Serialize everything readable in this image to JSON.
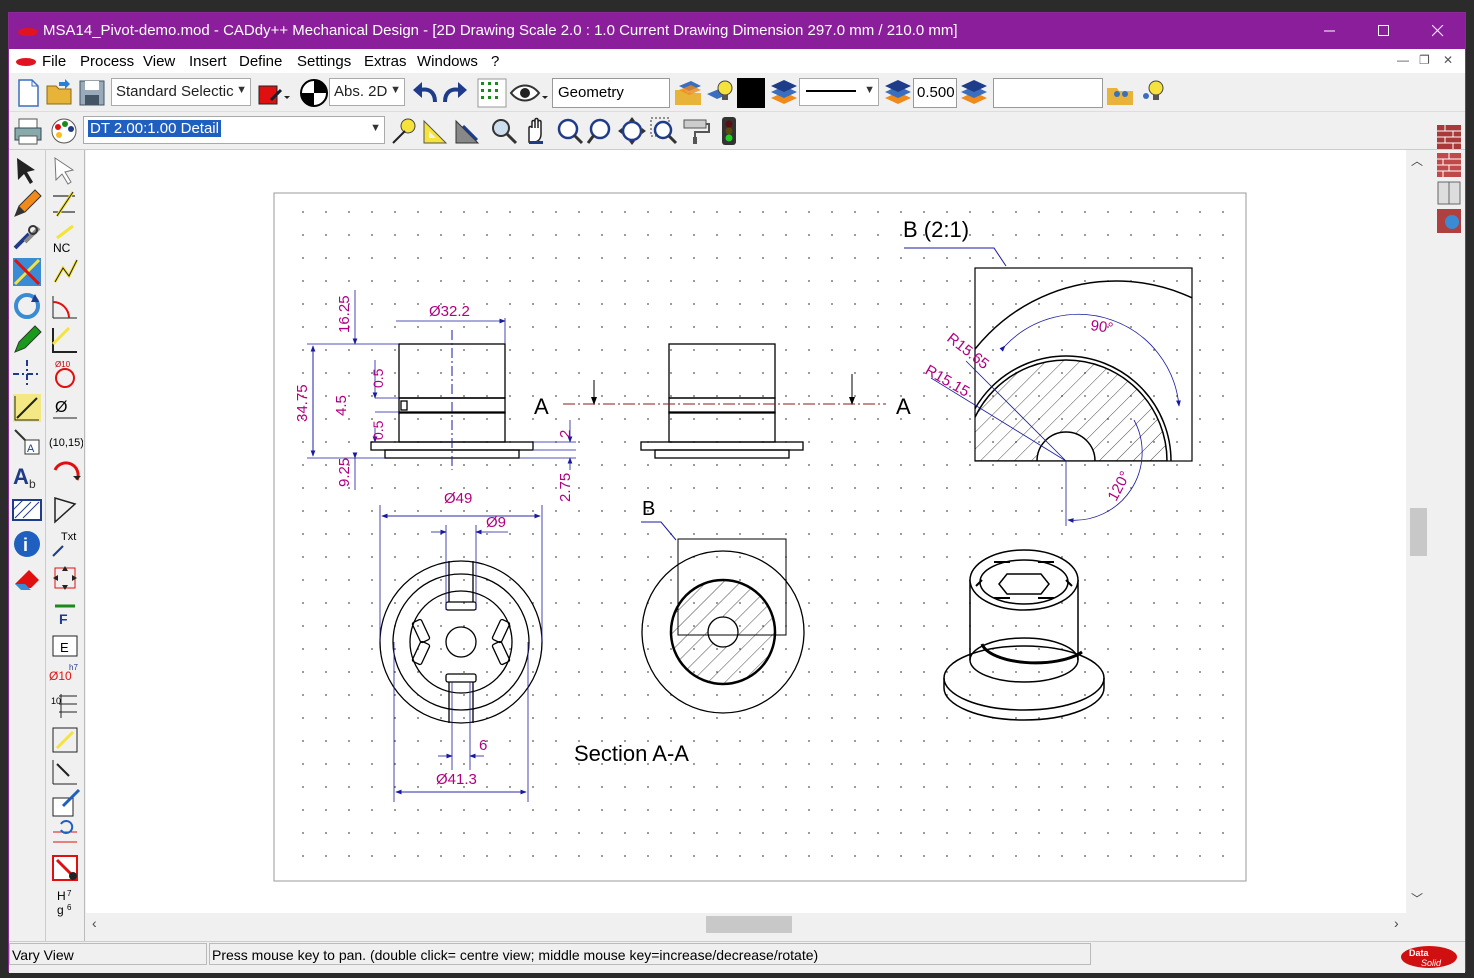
{
  "window": {
    "title": "MSA14_Pivot-demo.mod  -  CADdy++ Mechanical Design - [2D Drawing   Scale 2.0 : 1.0   Current Drawing Dimension 297.0 mm / 210.0 mm]"
  },
  "menu": {
    "items": [
      "File",
      "Process",
      "View",
      "Insert",
      "Define",
      "Settings",
      "Extras",
      "Windows",
      "?"
    ]
  },
  "toolbar": {
    "selection_mode": "Standard Selectic",
    "coord_mode": "Abs. 2D",
    "layer_name": "Geometry",
    "line_width": "0.500",
    "free_field": "",
    "detail_view": "DT 2.00:1.00 Detail"
  },
  "drawing": {
    "dims": {
      "d32": "Ø32.2",
      "h1625": "16.25",
      "h3475": "34.75",
      "h05a": "0.5",
      "h45": "4.5",
      "h05b": "0.5",
      "h925": "9.25",
      "h2": "2",
      "h275": "2.75",
      "d49": "Ø49",
      "d9": "Ø9",
      "w6": "6",
      "d413": "Ø41.3",
      "r1565": "R15.65",
      "r1515": "R15.15",
      "a90": "90°",
      "a120": "120°"
    },
    "labels": {
      "section_left": "A",
      "section_right": "A",
      "detail_title": "B  (2:1)",
      "detail_ref": "B",
      "section_title": "Section A-A"
    }
  },
  "status": {
    "mode": "Vary View",
    "hint": "Press mouse key to pan. (double click= centre view; middle mouse key=increase/decrease/rotate)",
    "brand": "Data Solid"
  },
  "colors": {
    "titlebar": "#8b1f9b",
    "dimension": "#b0007f",
    "dimline": "#1a1aa0",
    "section": "#8b1a1a"
  }
}
